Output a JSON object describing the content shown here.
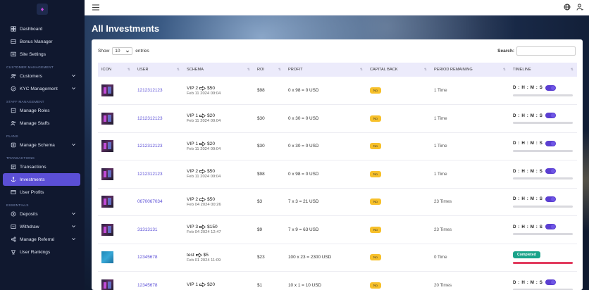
{
  "sidebar": {
    "items": [
      {
        "key": "dashboard",
        "label": "Dashboard",
        "icon": "dashboard-icon",
        "chevron": false
      },
      {
        "key": "bonus",
        "label": "Bonus Manager",
        "icon": "bonus-icon",
        "chevron": false
      },
      {
        "key": "site",
        "label": "Site Settings",
        "icon": "settings-icon",
        "chevron": false
      }
    ],
    "sec_customer": "CUSTOMER MANAGEMENT",
    "customers": "Customers",
    "kyc": "KYC Management",
    "sec_staff": "STAFF MANAGEMENT",
    "roles": "Manage Roles",
    "staffs": "Manage Staffs",
    "sec_plans": "PLANS",
    "schema": "Manage Schema",
    "sec_transactions": "TRANSACTIONS",
    "transactions": "Transactions",
    "investments": "Investments",
    "user_profits": "User Profits",
    "sec_essentials": "ESSENTIALS",
    "deposits": "Deposits",
    "withdraw": "Withdraw",
    "referral": "Manage Referral",
    "rankings": "User Rankings"
  },
  "page": {
    "title": "All Investments"
  },
  "controls": {
    "show": "Show",
    "entries_value": "10",
    "entries": "entries",
    "search_label": "Search:"
  },
  "table": {
    "headers": [
      "ICON",
      "USER",
      "SCHEMA",
      "ROI",
      "PROFIT",
      "CAPITAL BACK",
      "PERIOD REMAINING",
      "TIMELINE"
    ],
    "rows": [
      {
        "icon": "thumb",
        "user": "1212312123",
        "plan": "VIP 2",
        "amount": "$50",
        "date": "Feb 11 2024 09:04",
        "roi": "$98",
        "profit": "0 x 98 = 0 USD",
        "capital": "No",
        "remaining": "1 Time",
        "timeline": "D : H : M : S",
        "progress": 0
      },
      {
        "icon": "thumb",
        "user": "1212312123",
        "plan": "VIP 1",
        "amount": "$20",
        "date": "Feb 11 2024 09:04",
        "roi": "$30",
        "profit": "0 x 30 = 0 USD",
        "capital": "No",
        "remaining": "1 Time",
        "timeline": "D : H : M : S",
        "progress": 0
      },
      {
        "icon": "thumb",
        "user": "1212312123",
        "plan": "VIP 1",
        "amount": "$20",
        "date": "Feb 11 2024 09:04",
        "roi": "$30",
        "profit": "0 x 30 = 0 USD",
        "capital": "No",
        "remaining": "1 Time",
        "timeline": "D : H : M : S",
        "progress": 0
      },
      {
        "icon": "thumb",
        "user": "1212312123",
        "plan": "VIP 2",
        "amount": "$50",
        "date": "Feb 11 2024 09:04",
        "roi": "$98",
        "profit": "0 x 98 = 0 USD",
        "capital": "No",
        "remaining": "1 Time",
        "timeline": "D : H : M : S",
        "progress": 0
      },
      {
        "icon": "thumb",
        "user": "0670067034",
        "plan": "VIP 2",
        "amount": "$50",
        "date": "Feb 04 2024 00:26",
        "roi": "$3",
        "profit": "7 x 3 = 21 USD",
        "capital": "No",
        "remaining": "23 Times",
        "timeline": "D : H : M : S",
        "progress": 0
      },
      {
        "icon": "thumb",
        "user": "31313131",
        "plan": "VIP 3",
        "amount": "$150",
        "date": "Feb 04 2024 12:47",
        "roi": "$9",
        "profit": "7 x 9 = 63 USD",
        "capital": "No",
        "remaining": "23 Times",
        "timeline": "D : H : M : S",
        "progress": 0
      },
      {
        "icon": "thumb-blue",
        "user": "12345678",
        "plan": "test",
        "amount": "$5",
        "date": "Feb 01 2024 11:09",
        "roi": "$23",
        "profit": "100 x 23 = 2300 USD",
        "capital": "No",
        "remaining": "0 Time",
        "timeline": "Completed",
        "progress": 100
      },
      {
        "icon": "thumb",
        "user": "12345678",
        "plan": "VIP 1",
        "amount": "$20",
        "date": "",
        "roi": "$1",
        "profit": "10 x 1 = 10 USD",
        "capital": "No",
        "remaining": "20 Times",
        "timeline": "D : H : M : S",
        "progress": 0
      }
    ]
  },
  "colors": {
    "sidebar_bg": "#10182f",
    "active": "#5b4fd6",
    "accent": "#5a4ed6",
    "badge_yellow": "#f7c02a",
    "completed": "#1aa38a",
    "progress_done": "#e23b5e"
  }
}
